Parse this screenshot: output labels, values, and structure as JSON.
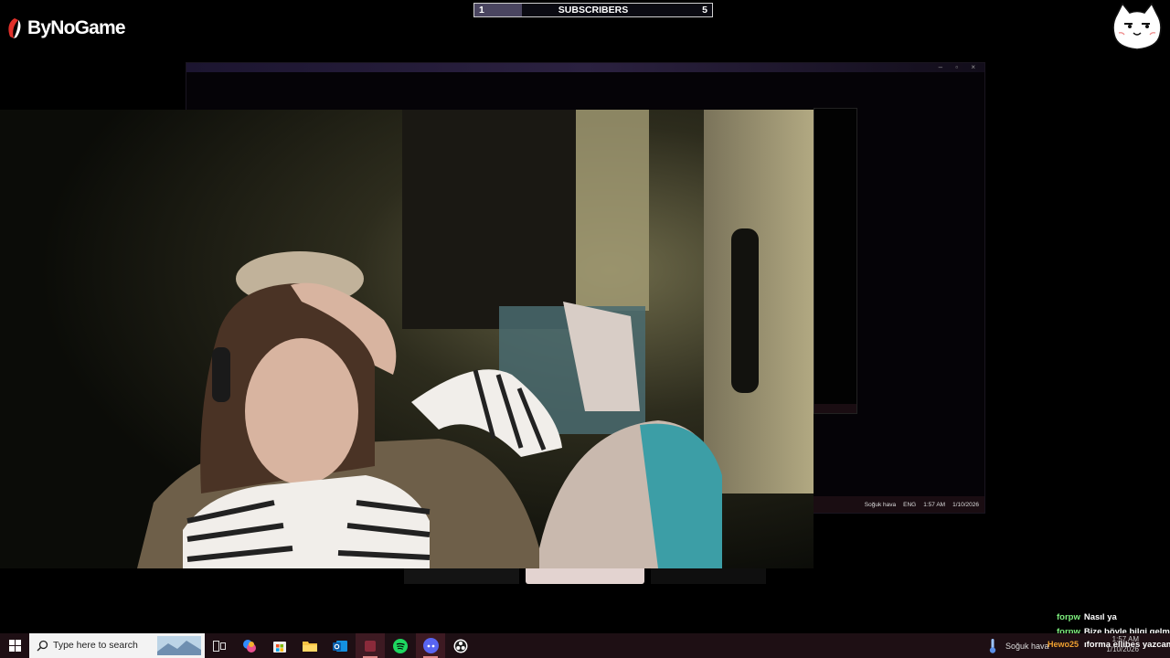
{
  "overlay": {
    "logo_text": "ByNoGame",
    "subscribers": {
      "current": "1",
      "label": "SUBSCRIBERS",
      "goal": "5",
      "progress": 0.2
    }
  },
  "desktop": {
    "tray_weather": "Soğuk hava",
    "tray_lang": "ENG",
    "tray_time": "1:57 AM",
    "tray_date": "1/10/2026"
  },
  "chat": [
    {
      "user": "forpw",
      "message": "Nasıl ya"
    },
    {
      "user": "forpw",
      "message": "Bize böyle bilgi gelme"
    }
  ],
  "chat_ticker": {
    "user": "Hewo25",
    "message": "ıforma ellibes yazcam"
  },
  "taskbar": {
    "search_placeholder": "Type here to search",
    "weather": "Soğuk hava",
    "time": "1:57 AM",
    "date": "1/10/2026",
    "apps": [
      "task-view-icon",
      "copilot-icon",
      "store-icon",
      "file-explorer-icon",
      "outlook-icon",
      "app-icon",
      "spotify-icon",
      "discord-icon",
      "obs-icon"
    ]
  },
  "colors": {
    "accent": "#d88a8a",
    "chat_user": "#7ef07e",
    "taskbar": "#1e0f14"
  }
}
